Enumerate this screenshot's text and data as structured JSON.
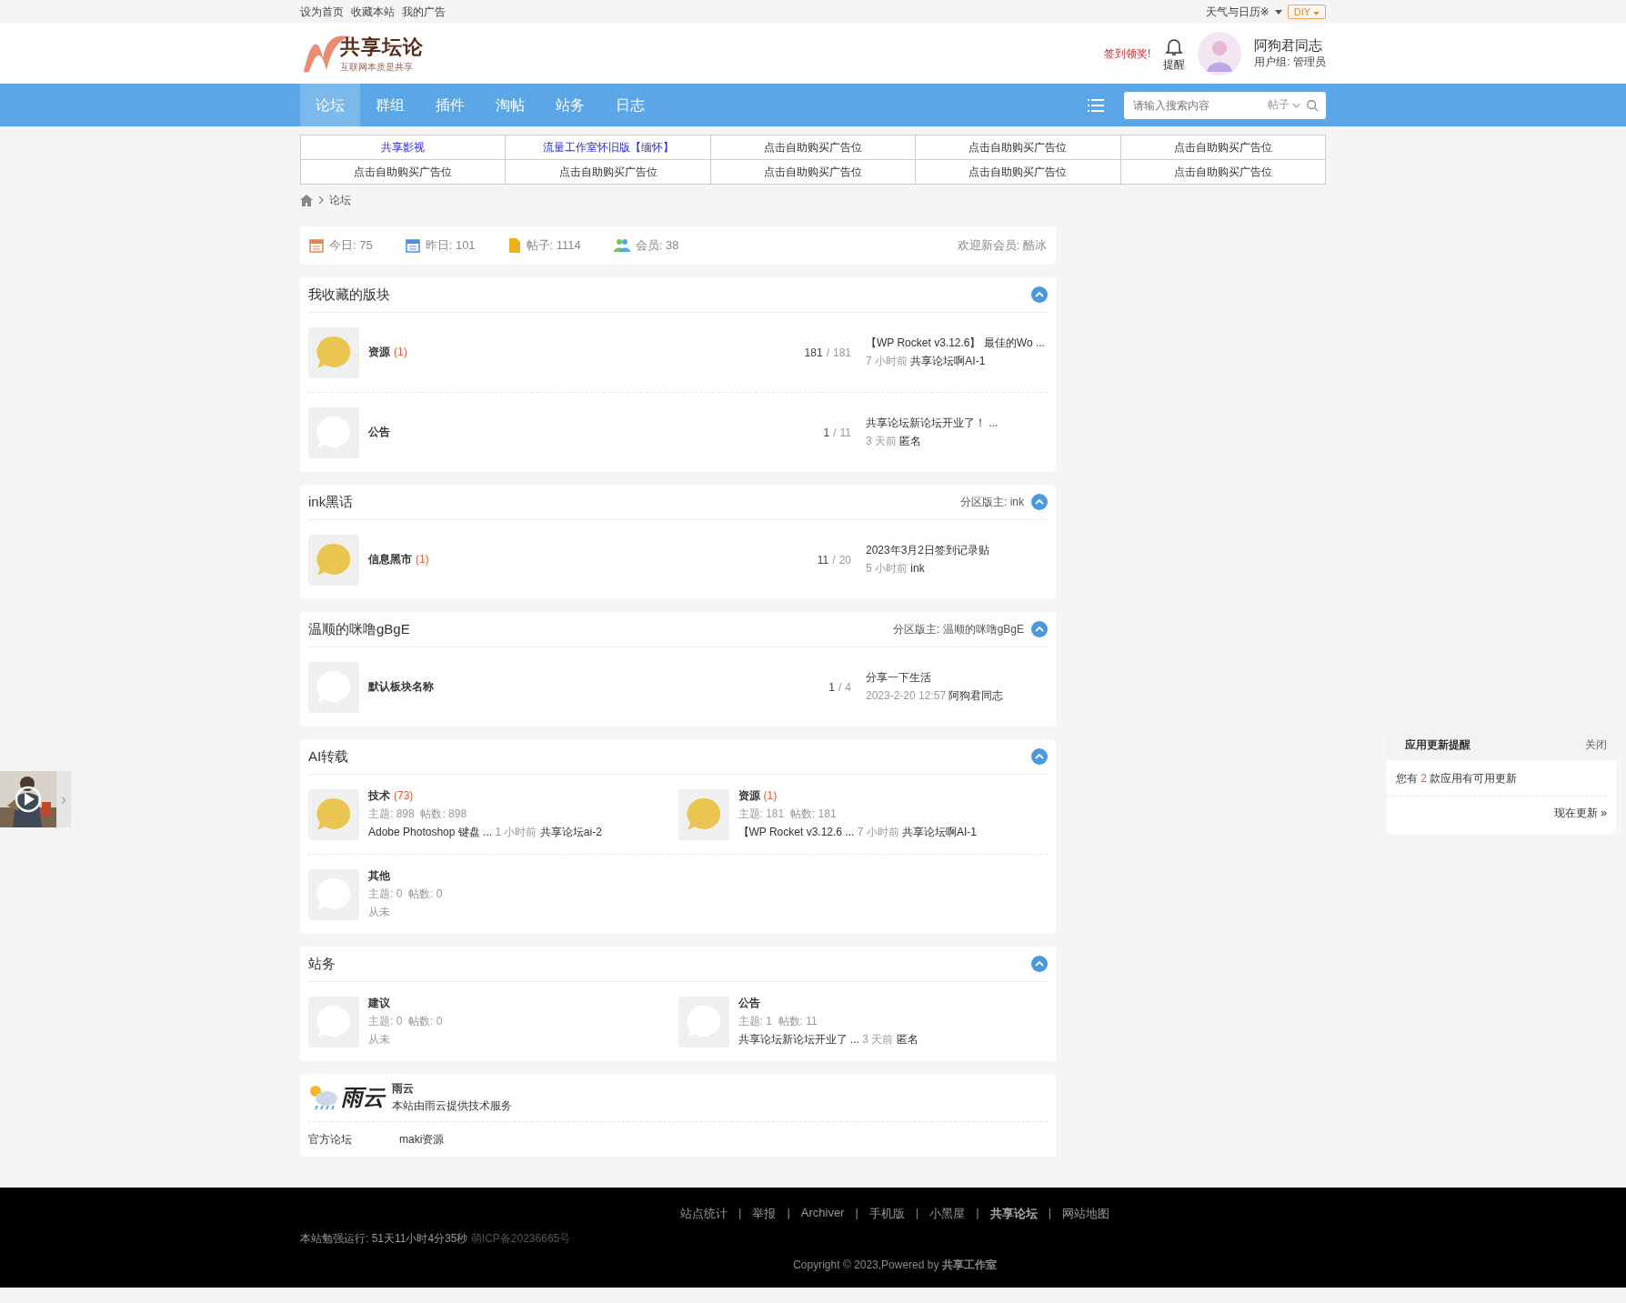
{
  "topbar": {
    "links": [
      "设为首页",
      "收藏本站",
      "我的广告"
    ],
    "weather": "天气与日历※",
    "diy": "DIY"
  },
  "header": {
    "logo_title": "共享坛论",
    "logo_subtitle": "互联网本质是共享",
    "checkin": "签到领奖!",
    "bell_label": "提醒",
    "user_name": "阿狗君同志",
    "user_group": "用户组: 管理员"
  },
  "nav": {
    "items": [
      {
        "label": "论坛",
        "selected": true
      },
      {
        "label": "群组",
        "selected": false
      },
      {
        "label": "插件",
        "selected": false
      },
      {
        "label": "淘帖",
        "selected": false
      },
      {
        "label": "站务",
        "selected": false
      },
      {
        "label": "日志",
        "selected": false
      }
    ],
    "search": {
      "placeholder": "请输入搜索内容",
      "type": "帖子"
    }
  },
  "ads": [
    {
      "text": "共享影视",
      "kind": "link"
    },
    {
      "text": "流量工作室怀旧版【缅怀】",
      "kind": "link"
    },
    {
      "text": "点击自助购买广告位",
      "kind": "ad"
    },
    {
      "text": "点击自助购买广告位",
      "kind": "ad"
    },
    {
      "text": "点击自助购买广告位",
      "kind": "ad"
    },
    {
      "text": "点击自助购买广告位",
      "kind": "ad"
    },
    {
      "text": "点击自助购买广告位",
      "kind": "ad"
    },
    {
      "text": "点击自助购买广告位",
      "kind": "ad"
    },
    {
      "text": "点击自助购买广告位",
      "kind": "ad"
    },
    {
      "text": "点击自助购买广告位",
      "kind": "ad"
    }
  ],
  "breadcrumb": [
    "论坛"
  ],
  "count_separator": "/",
  "stats": {
    "items": [
      {
        "kind": "today",
        "text": "今日: 75"
      },
      {
        "kind": "yesterday",
        "text": "昨日: 101"
      },
      {
        "kind": "posts",
        "text": "帖子: 1114"
      },
      {
        "kind": "members",
        "text": "会员: 38"
      }
    ],
    "welcome": "欢迎新会员: 酷冰"
  },
  "sections": [
    {
      "title": "我收藏的版块",
      "kind": "list",
      "expanded": true,
      "forums": [
        {
          "name": "资源",
          "count": "(1)",
          "has_new": true,
          "threads": "181",
          "posts": "181",
          "last_title": "【WP Rocket v3.12.6】 最佳的Wo ...",
          "last_time": "7 小时前",
          "last_user": "共享论坛啊AI-1"
        },
        {
          "name": "公告",
          "has_new": false,
          "threads": "1",
          "posts": "11",
          "last_title": "共享论坛新论坛开业了！ ...",
          "last_time": "3 天前",
          "last_user": "匿名"
        }
      ]
    },
    {
      "title": "ink黑话",
      "moderator": "分区版主: ink",
      "kind": "list",
      "expanded": true,
      "forums": [
        {
          "name": "信息黑市",
          "count": "(1)",
          "has_new": true,
          "threads": "11",
          "posts": "20",
          "last_title": "2023年3月2日签到记录贴",
          "last_time": "5 小时前",
          "last_user": "ink"
        }
      ]
    },
    {
      "title": "温顺的咪噜gBgE",
      "moderator": "分区版主: 温顺的咪噜gBgE",
      "kind": "list",
      "expanded": true,
      "forums": [
        {
          "name": "默认板块名称",
          "has_new": false,
          "threads": "1",
          "posts": "4",
          "last_title": "分享一下生活",
          "last_time": "2023-2-20 12:57",
          "last_user": "阿狗君同志"
        }
      ]
    },
    {
      "title": "AI转载",
      "kind": "grid",
      "expanded": true,
      "forums": [
        {
          "name": "技术",
          "count": "(73)",
          "has_new": true,
          "topics": "主题: 898",
          "posts": "帖数: 898",
          "last_title": "Adobe Photoshop 键盘 ...",
          "last_time": "1 小时前",
          "last_user": "共享论坛ai-2"
        },
        {
          "name": "资源",
          "count": "(1)",
          "has_new": true,
          "topics": "主题: 181",
          "posts": "帖数: 181",
          "last_title": "【WP Rocket v3.12.6 ...",
          "last_time": "7 小时前",
          "last_user": "共享论坛啊AI-1"
        },
        {
          "name": "其他",
          "has_new": false,
          "topics": "主题: 0",
          "posts": "帖数: 0",
          "never": "从未"
        }
      ]
    },
    {
      "title": "站务",
      "kind": "grid",
      "expanded": true,
      "forums": [
        {
          "name": "建议",
          "has_new": false,
          "topics": "主题: 0",
          "posts": "帖数: 0",
          "never": "从未"
        },
        {
          "name": "公告",
          "has_new": false,
          "topics": "主题: 1",
          "posts": "帖数: 11",
          "last_title": "共享论坛新论坛开业了 ...",
          "last_time": "3 天前",
          "last_user": "匿名"
        }
      ]
    }
  ],
  "partner": {
    "logo_text": "雨云",
    "name": "雨云",
    "description": "本站由雨云提供技术服务",
    "links": [
      "官方论坛",
      "maki资源"
    ]
  },
  "footer": {
    "links": [
      {
        "text": "站点统计",
        "bold": false
      },
      {
        "text": "举报",
        "bold": false
      },
      {
        "text": "Archiver",
        "bold": false
      },
      {
        "text": "手机版",
        "bold": false
      },
      {
        "text": "小黑屋",
        "bold": false
      },
      {
        "text": "共享论坛",
        "bold": true
      },
      {
        "text": "网站地图",
        "bold": false
      }
    ],
    "separator": "|",
    "runtime": "本站勉强运行: 51天11小时4分35秒",
    "icp": "萌ICP备20236665号",
    "copyright": "Copyright © 2023,Powered by **共享工作室**"
  },
  "popup": {
    "title": "应用更新提醒",
    "close": "关闭",
    "message_before": "您有",
    "count": "2",
    "message_after": "款应用有可用更新",
    "action": "现在更新 »"
  },
  "video_widget": {
    "kind": "picture",
    "arrow": "›"
  }
}
